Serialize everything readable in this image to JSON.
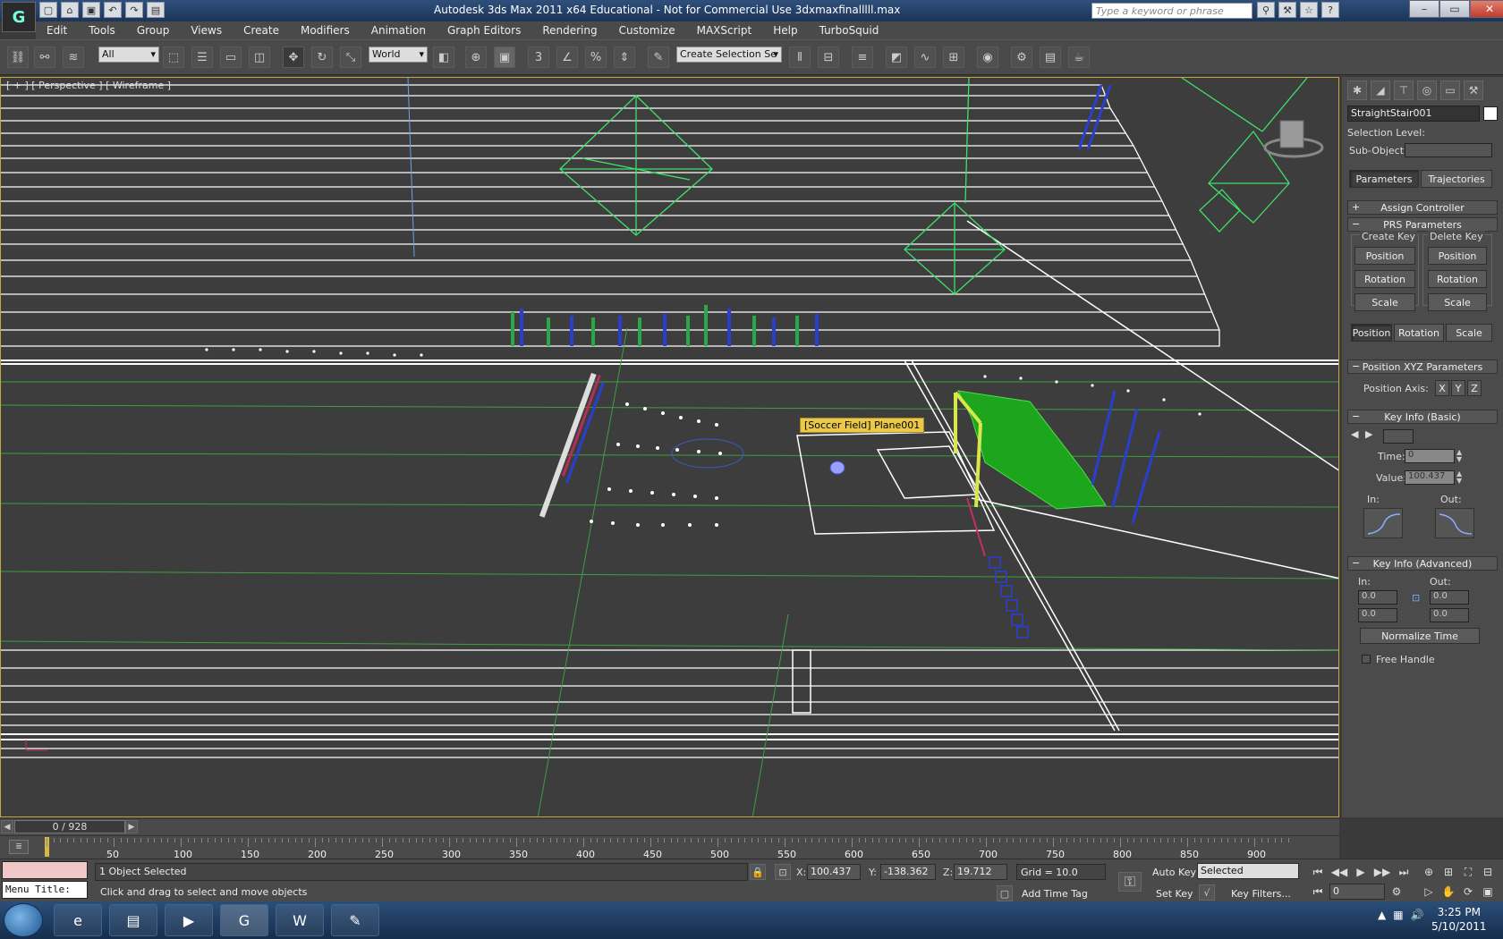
{
  "window": {
    "title": "Autodesk 3ds Max  2011 x64   Educational - Not for Commercial Use   3dxmaxfinalllll.max",
    "search_placeholder": "Type a keyword or phrase"
  },
  "menu": [
    "Edit",
    "Tools",
    "Group",
    "Views",
    "Create",
    "Modifiers",
    "Animation",
    "Graph Editors",
    "Rendering",
    "Customize",
    "MAXScript",
    "Help",
    "TurboSquid"
  ],
  "toolbar": {
    "selection_filter": "All",
    "reference_coord": "World",
    "named_selection": "Create Selection Se"
  },
  "viewport": {
    "label": "[ + ] [ Perspective ] [ Wireframe ]",
    "tooltip": "[Soccer Field] Plane001"
  },
  "command_panel": {
    "object_name": "StraightStair001",
    "selection_level_label": "Selection Level:",
    "sub_object_label": "Sub-Object",
    "tabs": [
      "Parameters",
      "Trajectories"
    ],
    "assign_controller": "Assign Controller",
    "prs_parameters": "PRS Parameters",
    "create_key": "Create Key",
    "delete_key": "Delete Key",
    "key_buttons": [
      "Position",
      "Rotation",
      "Scale"
    ],
    "prs_tabs": [
      "Position",
      "Rotation",
      "Scale"
    ],
    "position_xyz": "Position XYZ Parameters",
    "position_axis_label": "Position Axis:",
    "axes": [
      "X",
      "Y",
      "Z"
    ],
    "key_info_basic": "Key Info (Basic)",
    "time_label": "Time:",
    "time_value": "0",
    "value_label": "Value:",
    "value_value": "100.437",
    "in_label": "In:",
    "out_label": "Out:",
    "key_info_advanced": "Key Info (Advanced)",
    "adv_in_label": "In:",
    "adv_out_label": "Out:",
    "adv_values": [
      "0.0",
      "0.0",
      "0.0",
      "0.0"
    ],
    "normalize_time": "Normalize Time",
    "free_handle": "Free Handle"
  },
  "time_slider": {
    "frame_text": "0 / 928",
    "ticks": [
      "50",
      "100",
      "150",
      "200",
      "250",
      "300",
      "350",
      "400",
      "450",
      "500",
      "550",
      "600",
      "650",
      "700",
      "750",
      "800",
      "850",
      "900"
    ]
  },
  "status": {
    "menu_title": "Menu Title:",
    "selection": "1 Object Selected",
    "prompt": "Click and drag to select and move objects",
    "x_label": "X:",
    "x_value": "100.437",
    "y_label": "Y:",
    "y_value": "-138.362",
    "z_label": "Z:",
    "z_value": "19.712",
    "grid": "Grid = 10.0",
    "add_time_tag": "Add Time Tag",
    "auto_key": "Auto Key",
    "set_key": "Set Key",
    "key_mode": "Selected",
    "key_filters": "Key Filters...",
    "current_frame": "0"
  },
  "taskbar": {
    "time": "3:25 PM",
    "date": "5/10/2011"
  },
  "colors": {
    "viewport_bg": "#3d3d3d",
    "active_border": "#c6a83a",
    "wire_white": "#ffffff",
    "wire_green": "#3fe06a",
    "net_green": "#1da51d",
    "goal_yellow": "#d6e84a",
    "blue": "#2a3fd0"
  }
}
